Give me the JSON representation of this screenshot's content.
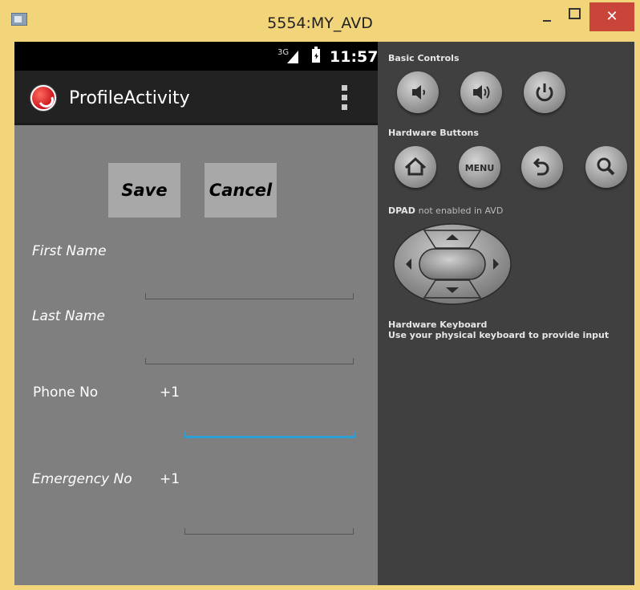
{
  "window": {
    "title": "5554:MY_AVD",
    "close_glyph": "✕"
  },
  "status_bar": {
    "network": "3G",
    "time": "11:57"
  },
  "action_bar": {
    "title": "ProfileActivity",
    "app_icon": "phone-app-icon",
    "overflow_icon": "overflow-menu-icon"
  },
  "form": {
    "save_label": "Save",
    "cancel_label": "Cancel",
    "first_name_label": "First Name",
    "first_name_value": "",
    "last_name_label": "Last Name",
    "last_name_value": "",
    "phone_label": "Phone No",
    "phone_prefix": "+1",
    "phone_value": "",
    "emergency_label": "Emergency No",
    "emergency_prefix": "+1",
    "emergency_value": ""
  },
  "controls": {
    "basic_title": "Basic Controls",
    "basic_buttons": [
      "volume-down-icon",
      "volume-up-icon",
      "power-icon"
    ],
    "hardware_title": "Hardware Buttons",
    "hardware_buttons": [
      "home-icon",
      "menu-icon",
      "back-icon",
      "search-icon"
    ],
    "menu_label": "MENU",
    "dpad_title": "DPAD",
    "dpad_note": "not enabled in AVD",
    "keyboard_title": "Hardware Keyboard",
    "keyboard_note": "Use your physical keyboard to provide input"
  },
  "colors": {
    "title_bar": "#f2d47a",
    "close_button": "#c9453a",
    "phone_bg": "#7f7f7f",
    "action_bar": "#222222",
    "focus_accent": "#2e9fd6",
    "panel_bg": "#404040"
  }
}
